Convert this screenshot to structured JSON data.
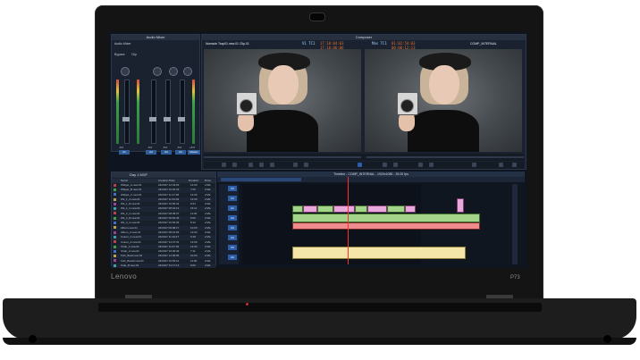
{
  "laptop": {
    "brand": "Lenovo",
    "model": "P73"
  },
  "app": {
    "composer_title": "Composer",
    "mixer_title": "Audio Mixer",
    "mixer_tab": "Audio Mixer",
    "timeline_title": "Timeline - COMP_INTERNAL - 1920x1080 - 25.00 fps",
    "bin_title": "Day 1 MXF",
    "source_clip_name": "Nomads Trap01.new.01 Clip.01",
    "record_name": "COMP_INTERNAL",
    "timecodes": {
      "source_v1": "V1 TC1",
      "source_tc1": "17:18:04:03",
      "source_tc2": "17:18:06:06",
      "record_mas": "Mas TC1",
      "record_tc1": "01:02:54:03",
      "record_tc2": "00:00:12:13"
    },
    "bin_columns": [
      "Name",
      "Creation Date",
      "Duration",
      "Drive"
    ],
    "bin_rows": [
      {
        "name": "Widget_A.new.01",
        "date": "24/2017 12:33:03",
        "dur": "12:00",
        "drive": "LIVE"
      },
      {
        "name": "Widget_B.new.01",
        "date": "24/2017 12:34:43",
        "dur": "7:00",
        "drive": "LIVE"
      },
      {
        "name": "Widget_C.new.01",
        "date": "24/2017 11:17:28",
        "dur": "14:00",
        "drive": "LIVE"
      },
      {
        "name": "Wk_1_A.new.01",
        "date": "24/2017 11:43:09",
        "dur": "12:00",
        "drive": "LIVE"
      },
      {
        "name": "Wk_1_B.new.01",
        "date": "24/2017 10:56:44",
        "dur": "9:24",
        "drive": "LIVE"
      },
      {
        "name": "Wk_1_C.new.01",
        "date": "24/2017 08:42:13",
        "dur": "15:11",
        "drive": "LIVE"
      },
      {
        "name": "Wk_2_A.new.01",
        "date": "24/2017 08:36:37",
        "dur": "11:00",
        "drive": "LIVE"
      },
      {
        "name": "Wk_2_B.new.01",
        "date": "24/2017 09:52:46",
        "dur": "6:00",
        "drive": "LIVE"
      },
      {
        "name": "Wk_3_A.new.01",
        "date": "24/2017 10:52:03",
        "dur": "8:12",
        "drive": "LIVE"
      },
      {
        "name": "Album.new.01",
        "date": "24/2017 09:08:17",
        "dur": "10:00",
        "drive": "LIVE"
      },
      {
        "name": "Album_2.new.01",
        "date": "24/2017 08:19:56",
        "dur": "12:04",
        "drive": "LIVE"
      },
      {
        "name": "Colour_C.new.01",
        "date": "24/2017 11:19:47",
        "dur": "9:18",
        "drive": "LIVE"
      },
      {
        "name": "Colour_A.new.01",
        "date": "24/2017 14:47:31",
        "dur": "13:00",
        "drive": "LIVE"
      },
      {
        "name": "Chair_1.new.01",
        "date": "24/2017 11:07:39",
        "dur": "14:00",
        "drive": "LIVE"
      },
      {
        "name": "Chair_2.new.01",
        "date": "24/2017 15:36:49",
        "dur": "7:11",
        "drive": "LIVE"
      },
      {
        "name": "Fish_Bowl.new.01",
        "date": "24/2017 12:00:05",
        "dur": "10:00",
        "drive": "LIVE"
      },
      {
        "name": "Fish_Bowl2.new.01",
        "date": "24/2017 12:53:14",
        "dur": "11:00",
        "drive": "LIVE"
      },
      {
        "name": "Cafe_B.new.01",
        "date": "24/2017 13:17:13",
        "dur": "9:00",
        "drive": "LIVE"
      }
    ],
    "mixer_channels": [
      "A1",
      "A2",
      "A3",
      "A4",
      "Master"
    ],
    "mixer_values": [
      "-8.0",
      "-8.0",
      "-8.0",
      "-8.0",
      "+8.0"
    ],
    "mixer_labels": [
      "Bypass",
      "Clip"
    ],
    "tracks": [
      "V2",
      "V1",
      "A1",
      "A2",
      "A3",
      "A4",
      "A5",
      "A6"
    ],
    "colors": {
      "accent_blue": "#2c5ea8",
      "timecode_orange": "#e07030",
      "clip_pink": "#e9a8dc",
      "clip_green": "#a4d48a",
      "clip_red": "#f08c8c",
      "clip_yellow": "#f3e6a8"
    }
  }
}
